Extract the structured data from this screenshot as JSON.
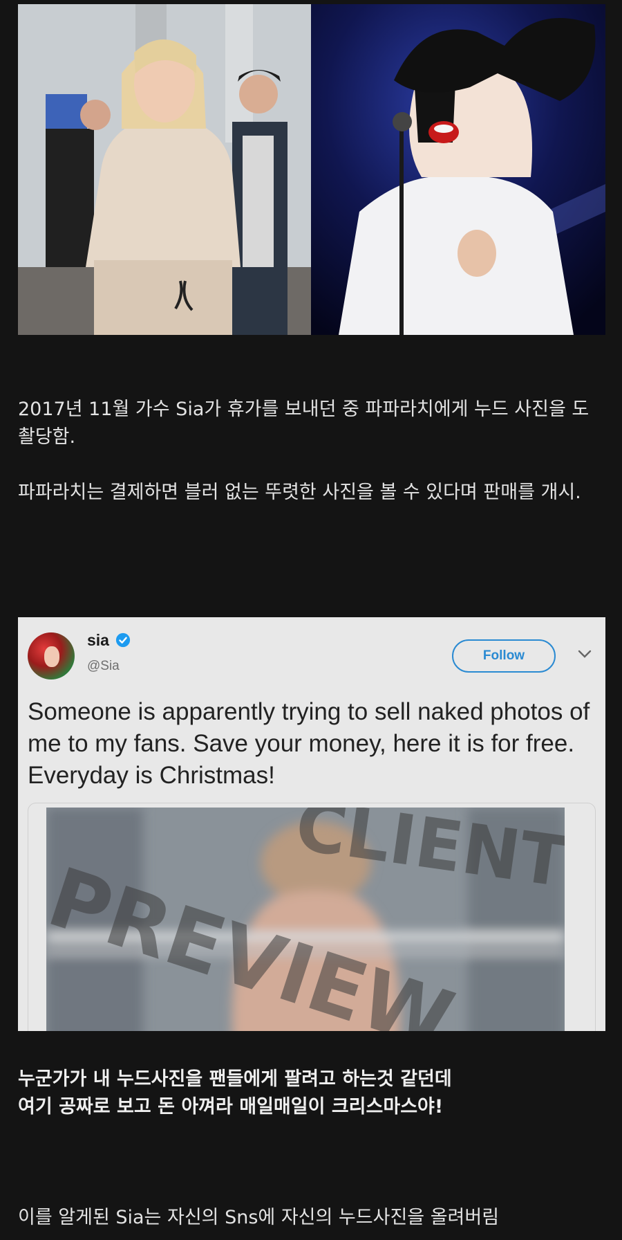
{
  "photos": {
    "left_alt": "",
    "right_alt": ""
  },
  "paragraphs": {
    "p1": "2017년 11월 가수 Sia가 휴가를 보내던 중 파파라치에게 누드 사진을 도촬당함.",
    "p2": "파파라치는 결제하면 블러 없는 뚜렷한 사진을 볼 수 있다며 판매를 개시.",
    "caption_line1": "누군가가 내 누드사진을 팬들에게 팔려고 하는것 같던데",
    "caption_line2": "여기 공짜로 보고 돈 아껴라 매일매일이 크리스마스야!",
    "p3": "이를 알게된 Sia는 자신의 Sns에 자신의 누드사진을 올려버림"
  },
  "tweet": {
    "user_name": "sia",
    "user_handle": "@Sia",
    "follow_label": "Follow",
    "text": "Someone is apparently trying to sell naked photos of me to my fans. Save your money, here it is for free. Everyday is Christmas!",
    "watermark_top": "CLIENT",
    "watermark_main": "PREVIEW"
  },
  "colors": {
    "background": "#141414",
    "accent_follow": "#2a8ad2",
    "verified": "#1d9bf0",
    "card": "#e8e8e8"
  },
  "icons": {
    "verified": "verified-badge-icon",
    "more": "chevron-down-icon"
  }
}
